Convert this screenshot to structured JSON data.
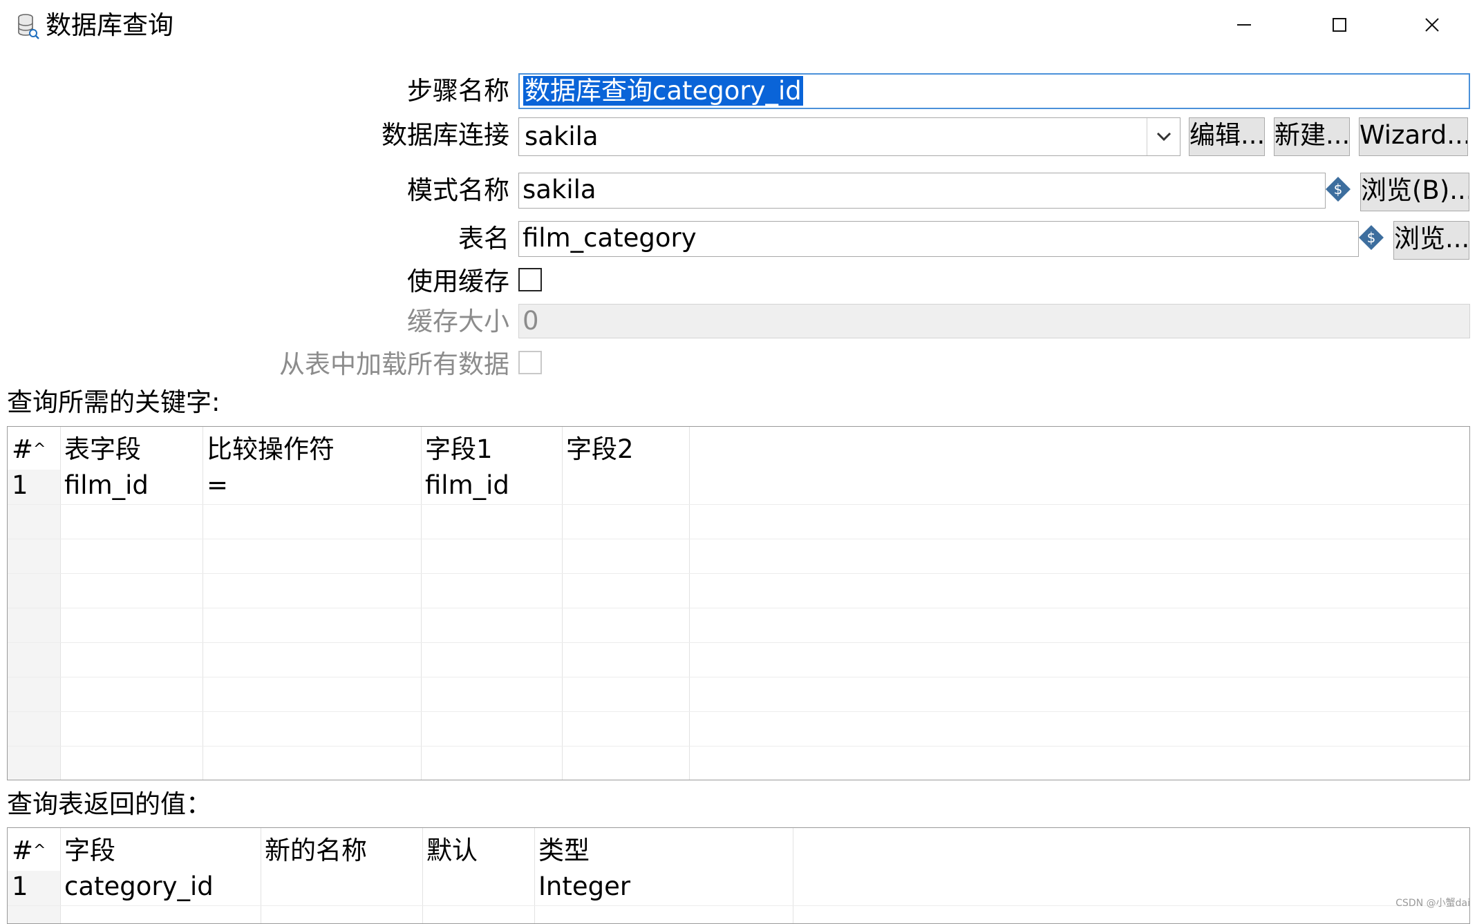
{
  "window": {
    "title": "数据库查询",
    "minimize_glyph": "—",
    "maximize_glyph": "☐",
    "close_glyph": "✕",
    "icon": "database-search-icon"
  },
  "form": {
    "step_name_label": "步骤名称",
    "step_name_value": "数据库查询category_id",
    "db_connection_label": "数据库连接",
    "db_connection_value": "sakila",
    "edit_button": "编辑...",
    "new_button": "新建...",
    "wizard_button": "Wizard...",
    "schema_label": "模式名称",
    "schema_value": "sakila",
    "schema_browse_button": "浏览(B)...",
    "table_label": "表名",
    "table_value": "film_category",
    "table_browse_button": "浏览...",
    "use_cache_label": "使用缓存",
    "use_cache_checked": false,
    "cache_size_label": "缓存大小",
    "cache_size_value": "0",
    "load_all_label": "从表中加载所有数据",
    "load_all_checked": false
  },
  "keys_section": {
    "title": "查询所需的关键字:",
    "columns": [
      "#",
      "表字段",
      "比较操作符",
      "字段1",
      "字段2"
    ],
    "rows": [
      {
        "num": "1",
        "table_field": "film_id",
        "comparator": "=",
        "field1": "film_id",
        "field2": ""
      }
    ]
  },
  "return_section": {
    "title": "查询表返回的值：",
    "columns": [
      "#",
      "字段",
      "新的名称",
      "默认",
      "类型"
    ],
    "rows": [
      {
        "num": "1",
        "field": "category_id",
        "new_name": "",
        "default": "",
        "type": "Integer"
      }
    ]
  },
  "colors": {
    "selection": "#0a64d8",
    "focus_border": "#4a90d9",
    "button_bg": "#e4e4e4",
    "variable_icon": "#3d6e9e"
  },
  "watermark": "CSDN @小蟹dai"
}
